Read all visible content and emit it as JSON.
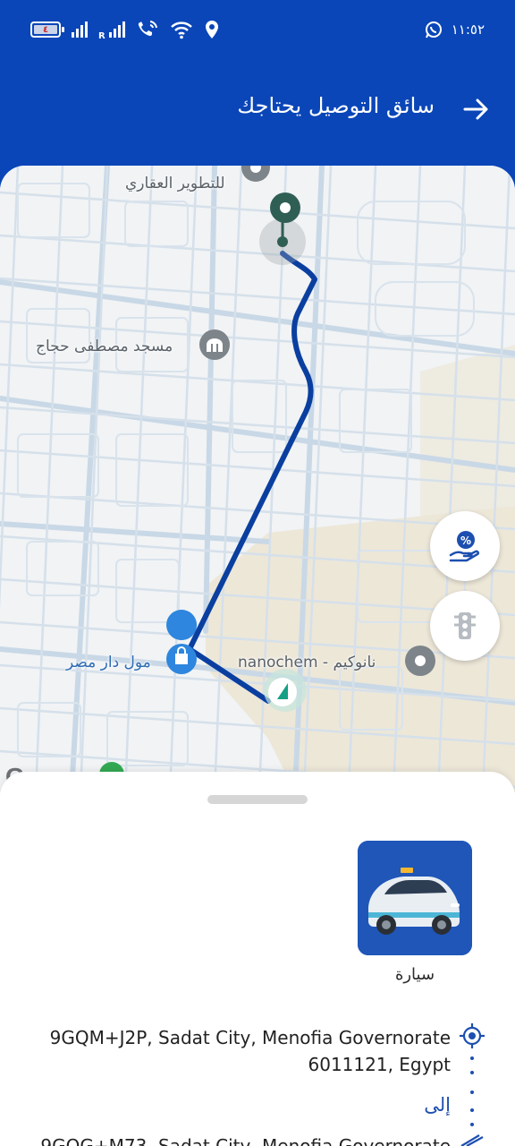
{
  "status_bar": {
    "battery_level": "٤",
    "network_roaming_label": "R",
    "time": "١١:٥٢",
    "icons": [
      "battery-icon",
      "signal-icon",
      "signal-roaming-icon",
      "wifi-call-icon",
      "wifi-icon",
      "location-icon",
      "whatsapp-icon"
    ]
  },
  "header": {
    "title": "سائق التوصيل يحتاجك",
    "back_icon": "arrow-right-icon",
    "color": "#0a46b8"
  },
  "map": {
    "labels": {
      "real_estate": "للتطوير العقاري",
      "mosque": "مسجد مصطفى حجاج",
      "mall": "مول دار مصر",
      "company": "nanochem - نانوكيم"
    },
    "route_color": "#0a3fa0",
    "buttons": {
      "offers_icon": "discount-hand-icon",
      "traffic_icon": "traffic-light-icon"
    }
  },
  "sheet": {
    "vehicle_label": "سيارة",
    "from_address": "9GQM+J2P, Sadat City, Menofia Governorate 6011121, Egypt",
    "to_label": "إلى",
    "to_address": "9GQG+M73, Sadat City, Menofia Governorate"
  }
}
